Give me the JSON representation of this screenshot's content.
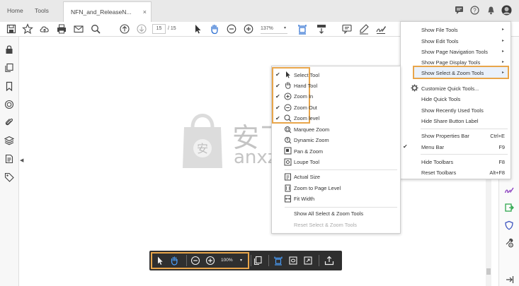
{
  "tabs": {
    "home": "Home",
    "tools": "Tools",
    "document": "NFN_and_ReleaseN...",
    "close": "×"
  },
  "toolbar": {
    "page_current": "15",
    "page_total": "/ 15",
    "zoom": "137%"
  },
  "main_menu": {
    "items": [
      {
        "label": "Show File Tools",
        "arrow": "▸"
      },
      {
        "label": "Show Edit Tools",
        "arrow": "▸"
      },
      {
        "label": "Show Page Navigation Tools",
        "arrow": "▸"
      },
      {
        "label": "Show Page Display Tools",
        "arrow": "▸"
      },
      {
        "label": "Show Select & Zoom Tools",
        "arrow": "▸"
      },
      {
        "label": "Customize Quick Tools..."
      },
      {
        "label": "Hide Quick Tools"
      },
      {
        "label": "Show Recently Used Tools"
      },
      {
        "label": "Hide Share Button Label"
      },
      {
        "label": "Show Properties Bar",
        "shortcut": "Ctrl+E"
      },
      {
        "label": "Menu Bar",
        "shortcut": "F9",
        "check": "✔"
      },
      {
        "label": "Hide Toolbars",
        "shortcut": "F8"
      },
      {
        "label": "Reset Toolbars",
        "shortcut": "Alt+F8"
      }
    ]
  },
  "submenu": {
    "items": [
      {
        "label": "Select Tool",
        "check": "✔"
      },
      {
        "label": "Hand Tool",
        "check": "✔"
      },
      {
        "label": "Zoom In",
        "check": "✔"
      },
      {
        "label": "Zoom Out",
        "check": "✔"
      },
      {
        "label": "Zoom level",
        "check": "✔"
      },
      {
        "label": "Marquee Zoom"
      },
      {
        "label": "Dynamic Zoom"
      },
      {
        "label": "Pan & Zoom"
      },
      {
        "label": "Loupe Tool"
      },
      {
        "label": "Actual Size"
      },
      {
        "label": "Zoom to Page Level"
      },
      {
        "label": "Fit Width"
      },
      {
        "label": "Show All Select & Zoom Tools"
      },
      {
        "label": "Reset Select & Zoom Tools"
      }
    ]
  },
  "floating_bar": {
    "zoom": "100%",
    "caret": "▾"
  },
  "watermark": {
    "text_cn": "安下载",
    "text_en": "anxz.com"
  },
  "colors": {
    "highlight": "#e8a54a",
    "accent": "#2d6fd1",
    "green": "#2fa84f",
    "purple": "#8a3fbf"
  }
}
